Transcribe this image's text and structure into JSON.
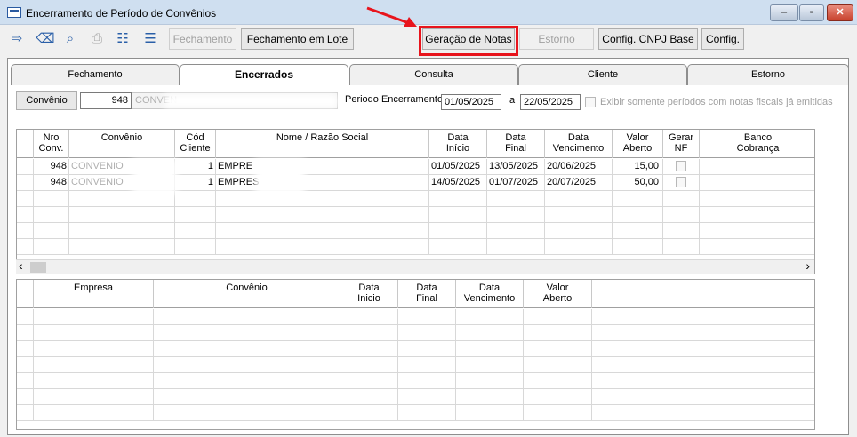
{
  "window": {
    "title": "Encerramento de Período de Convênios",
    "min_label": "‒",
    "max_label": "▫",
    "close_label": "✕"
  },
  "toolbar": {
    "icons": [
      {
        "name": "exit-icon",
        "glyph": "⇨"
      },
      {
        "name": "eraser-icon",
        "glyph": "⌫"
      },
      {
        "name": "search-icon",
        "glyph": "⌕"
      },
      {
        "name": "print-icon",
        "glyph": "⎙"
      },
      {
        "name": "list-check-icon",
        "glyph": "☷"
      },
      {
        "name": "list-icon",
        "glyph": "☰"
      }
    ],
    "fechamento": "Fechamento",
    "fechamento_lote": "Fechamento em Lote",
    "geracao_notas": "Geração de Notas",
    "estorno": "Estorno",
    "config_cnpj": "Config. CNPJ Base",
    "config": "Config."
  },
  "tabs": [
    "Fechamento",
    "Encerrados",
    "Consulta",
    "Cliente",
    "Estorno"
  ],
  "filters": {
    "convenio_label": "Convênio",
    "convenio_code": "948",
    "convenio_name": "CONVEN",
    "periodo_label": "Periodo Encerramento",
    "data_inicio": "01/05/2025",
    "a_label": "a",
    "data_fim": "22/05/2025",
    "checkbox_label": "Exibir somente períodos com notas fiscais já emitidas"
  },
  "grid1": {
    "headers": [
      "Nro\nConv.",
      "Convênio",
      "Cód\nCliente",
      "Nome / Razão Social",
      "Data\nInício",
      "Data\nFinal",
      "Data\nVencimento",
      "Valor\nAberto",
      "Gerar\nNF",
      "Banco\nCobrança"
    ],
    "rows": [
      {
        "nro": "948",
        "convenio": "CONVENIO",
        "cod": "1",
        "nome": "EMPRE",
        "inicio": "01/05/2025",
        "final": "13/05/2025",
        "venc": "20/06/2025",
        "valor": "15,00"
      },
      {
        "nro": "948",
        "convenio": "CONVENIO",
        "cod": "1",
        "nome": "EMPRES",
        "inicio": "14/05/2025",
        "final": "01/07/2025",
        "venc": "20/07/2025",
        "valor": "50,00"
      }
    ],
    "scroll_left": "‹",
    "scroll_right": "›"
  },
  "grid2": {
    "headers": [
      "Empresa",
      "Convênio",
      "Data\nInicio",
      "Data\nFinal",
      "Data\nVencimento",
      "Valor\nAberto"
    ]
  },
  "colors": {
    "highlight": "#e8141c",
    "arrow": "#e8141c"
  }
}
